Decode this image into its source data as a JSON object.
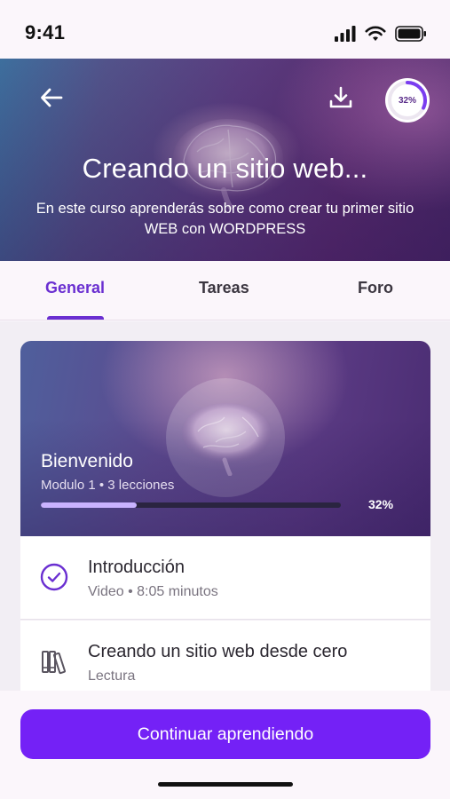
{
  "status_bar": {
    "time": "9:41",
    "icons": [
      "cellular-signal-icon",
      "wifi-icon",
      "battery-icon"
    ]
  },
  "hero": {
    "title": "Creando un sitio web...",
    "subtitle": "En este curso aprenderás sobre como crear tu primer sitio WEB con WORDPRESS",
    "progress_percent": 32,
    "progress_label": "32%",
    "icons": [
      "arrow-left-icon",
      "download-icon",
      "brain-image"
    ]
  },
  "tabs": [
    {
      "label": "General",
      "active": true
    },
    {
      "label": "Tareas",
      "active": false
    },
    {
      "label": "Foro",
      "active": false
    }
  ],
  "module": {
    "title": "Bienvenido",
    "meta": "Modulo 1 • 3 lecciones",
    "progress_percent": 32,
    "progress_label": "32%"
  },
  "lessons": [
    {
      "title": "Introducción",
      "subtitle": "Video • 8:05 minutos",
      "icon": "check-circle-icon"
    },
    {
      "title": "Creando un sitio web desde cero",
      "subtitle": "Lectura",
      "icon": "books-icon"
    }
  ],
  "cta": {
    "label": "Continuar aprendiendo"
  },
  "colors": {
    "accent": "#7421f6",
    "tab_active": "#6a2fd1",
    "progress_fill": "#c9b3ff"
  }
}
